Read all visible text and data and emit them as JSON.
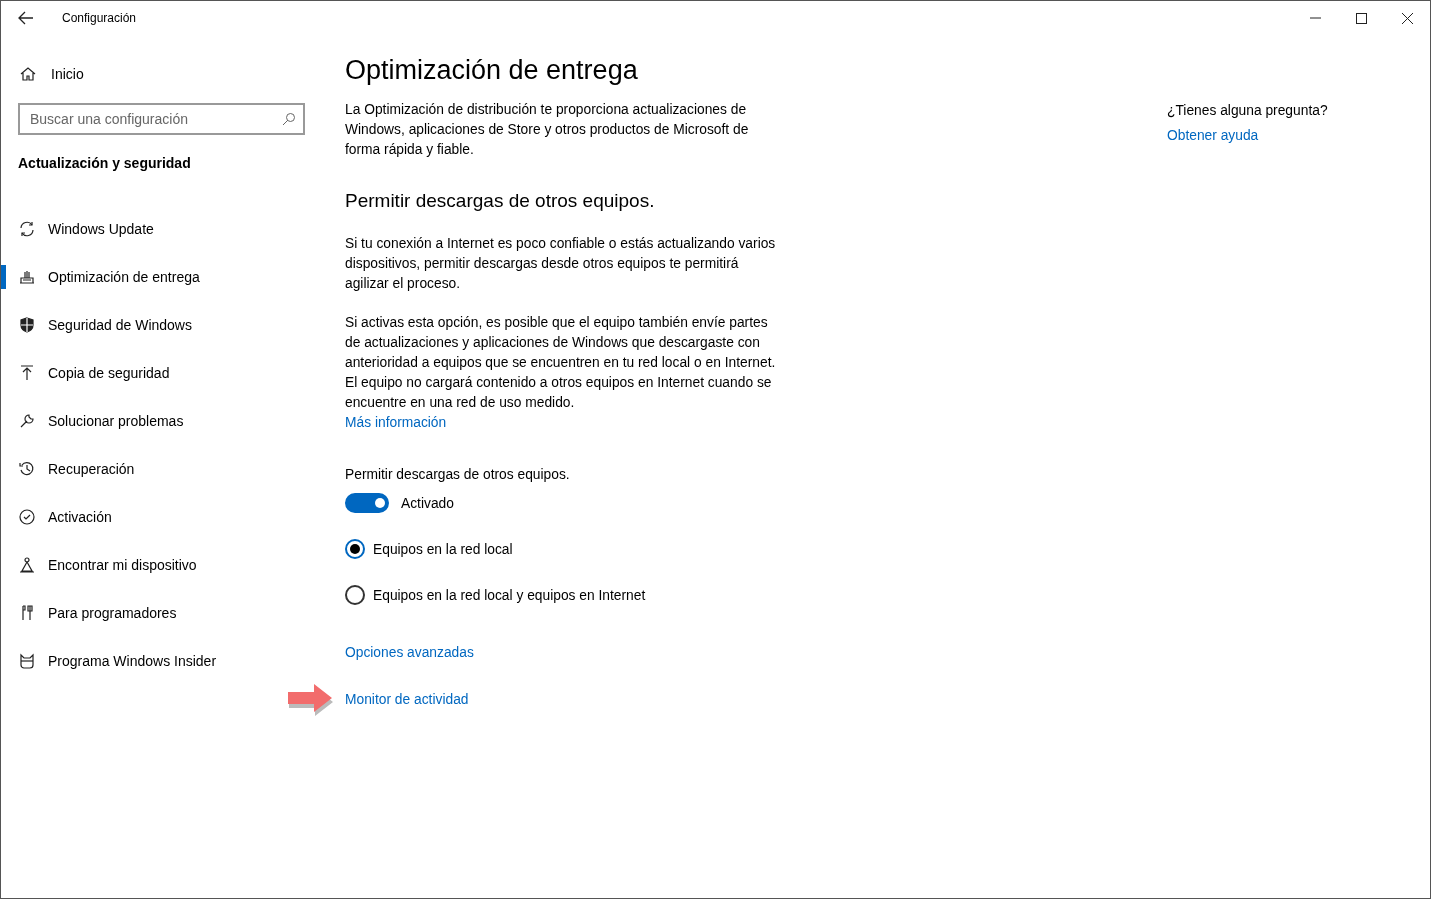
{
  "window": {
    "title": "Configuración"
  },
  "sidebar": {
    "home": "Inicio",
    "search": {
      "placeholder": "Buscar una configuración"
    },
    "section": "Actualización y seguridad",
    "items": [
      {
        "label": "Windows Update",
        "selected": false
      },
      {
        "label": "Optimización de entrega",
        "selected": true
      },
      {
        "label": "Seguridad de Windows",
        "selected": false
      },
      {
        "label": "Copia de seguridad",
        "selected": false
      },
      {
        "label": "Solucionar problemas",
        "selected": false
      },
      {
        "label": "Recuperación",
        "selected": false
      },
      {
        "label": "Activación",
        "selected": false
      },
      {
        "label": "Encontrar mi dispositivo",
        "selected": false
      },
      {
        "label": "Para programadores",
        "selected": false
      },
      {
        "label": "Programa Windows Insider",
        "selected": false
      }
    ]
  },
  "main": {
    "title": "Optimización de entrega",
    "intro": "La Optimización de distribución te proporciona actualizaciones de Windows, aplicaciones de Store y otros productos de Microsoft de forma rápida y fiable.",
    "subtitle": "Permitir descargas de otros equipos.",
    "paragraph_1": "Si tu conexión a Internet es poco confiable o estás actualizando varios dispositivos, permitir descargas desde otros equipos te permitirá agilizar el proceso.",
    "paragraph_2": "Si activas esta opción, es posible que el equipo también envíe partes de actualizaciones y aplicaciones de Windows que descargaste con anterioridad a equipos que se encuentren en tu red local o en Internet. El equipo no cargará contenido a otros equipos en Internet cuando se encuentre en una red de uso medido.",
    "more_link": "Más información",
    "toggle": {
      "label": "Permitir descargas de otros equipos.",
      "on": true,
      "state_text": "Activado"
    },
    "options": [
      {
        "label": "Equipos en la red local",
        "selected": true
      },
      {
        "label": "Equipos en la red local y equipos en Internet",
        "selected": false
      }
    ],
    "links": [
      "Opciones avanzadas",
      "Monitor de actividad"
    ]
  },
  "help": {
    "question": "¿Tienes alguna pregunta?",
    "link": "Obtener ayuda"
  }
}
